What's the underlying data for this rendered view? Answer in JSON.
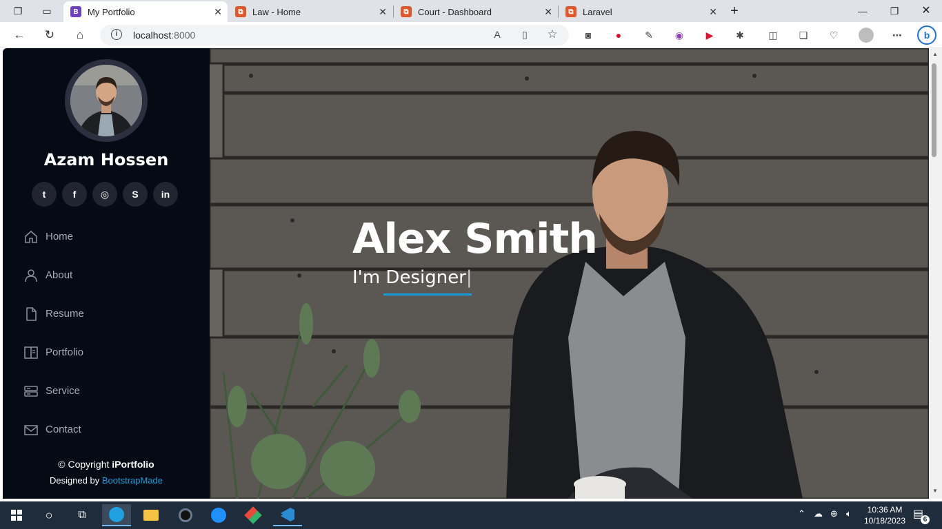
{
  "browser": {
    "tabs": [
      {
        "title": "My Portfolio",
        "favicon_letter": "B",
        "favicon_color": "#6f42c1",
        "active": true
      },
      {
        "title": "Law - Home",
        "favicon_letter": "⧉",
        "favicon_color": "#e0572a",
        "active": false
      },
      {
        "title": "Court - Dashboard",
        "favicon_letter": "⧉",
        "favicon_color": "#e0572a",
        "active": false
      },
      {
        "title": "Laravel",
        "favicon_letter": "⧉",
        "favicon_color": "#e0572a",
        "active": false
      }
    ],
    "new_tab": "+",
    "address": {
      "host": "localhost",
      "port": ":8000"
    }
  },
  "sidebar": {
    "name": "Azam Hossen",
    "socials": [
      {
        "icon": "twitter-icon",
        "glyph": "t"
      },
      {
        "icon": "facebook-icon",
        "glyph": "f"
      },
      {
        "icon": "instagram-icon",
        "glyph": "◎"
      },
      {
        "icon": "skype-icon",
        "glyph": "S"
      },
      {
        "icon": "linkedin-icon",
        "glyph": "in"
      }
    ],
    "nav": [
      {
        "label": "Home",
        "icon": "house-icon"
      },
      {
        "label": "About",
        "icon": "person-icon"
      },
      {
        "label": "Resume",
        "icon": "file-icon"
      },
      {
        "label": "Portfolio",
        "icon": "book-icon"
      },
      {
        "label": "Service",
        "icon": "server-icon"
      },
      {
        "label": "Contact",
        "icon": "envelope-icon"
      }
    ],
    "footer": {
      "copyright_prefix": "© Copyright ",
      "brand": "iPortfolio",
      "designed_by": "Designed by ",
      "designer": "BootstrapMade"
    }
  },
  "hero": {
    "title": "Alex Smith",
    "subtitle_prefix": "I'm ",
    "subtitle_role": "Designer",
    "accent_color": "#149ddd"
  },
  "taskbar": {
    "time": "10:36 AM",
    "date": "10/18/2023",
    "notifications": "6"
  }
}
